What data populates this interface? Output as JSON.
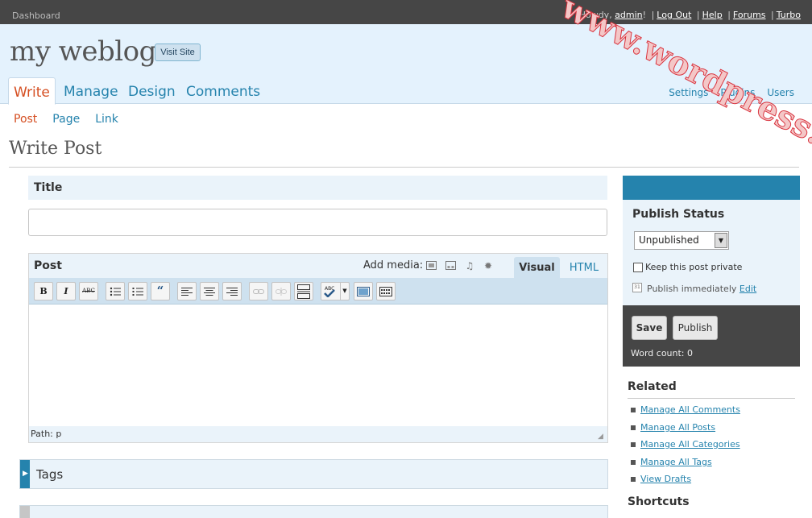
{
  "topbar": {
    "dashboard": "Dashboard",
    "howdy": "Howdy, ",
    "user": "admin",
    "bang": "!",
    "links": [
      "Log Out",
      "Help",
      "Forums",
      "Turbo"
    ]
  },
  "header": {
    "blog_name": "my weblog",
    "visit_site": "Visit Site"
  },
  "main_nav": [
    "Write",
    "Manage",
    "Design",
    "Comments"
  ],
  "secondary_nav": [
    "Settings",
    "Plugins",
    "Users"
  ],
  "sub_nav": [
    "Post",
    "Page",
    "Link"
  ],
  "page_title": "Write Post",
  "title_box": {
    "label": "Title",
    "value": ""
  },
  "post_box": {
    "label": "Post",
    "add_media": "Add media:",
    "tab_visual": "Visual",
    "tab_html": "HTML",
    "path": "Path: p",
    "toolbar": {
      "bold": "B",
      "italic": "I",
      "strike": "ABC",
      "spell": "ABC"
    }
  },
  "tags_box": {
    "label": "Tags"
  },
  "publish": {
    "status_label": "Publish Status",
    "status_value": "Unpublished",
    "keep_private": "Keep this post private",
    "publish_immediately": "Publish immediately",
    "edit": "Edit",
    "save": "Save",
    "publish": "Publish",
    "word_count": "Word count: 0"
  },
  "related": {
    "label": "Related",
    "items": [
      "Manage All Comments",
      "Manage All Posts",
      "Manage All Categories",
      "Manage All Tags",
      "View Drafts"
    ]
  },
  "shortcuts": {
    "label": "Shortcuts"
  },
  "watermark": "www.wordpress.la",
  "colors": {
    "accent": "#2583ad",
    "current": "#d54e21",
    "header_bg": "#e4f2fd",
    "topbar_bg": "#464646",
    "watermark": "#d9343f"
  }
}
